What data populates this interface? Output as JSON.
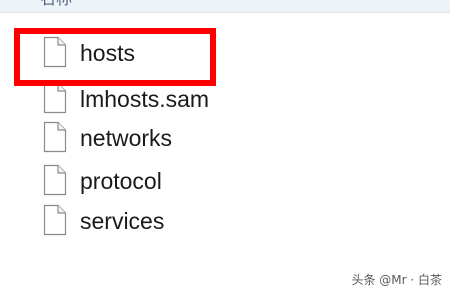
{
  "header": {
    "column_label": "名称"
  },
  "files": [
    {
      "name": "hosts",
      "icon": "file-icon",
      "highlighted": true
    },
    {
      "name": "lmhosts.sam",
      "icon": "file-icon",
      "highlighted": false
    },
    {
      "name": "networks",
      "icon": "file-icon",
      "highlighted": false
    },
    {
      "name": "protocol",
      "icon": "file-icon",
      "highlighted": false
    },
    {
      "name": "services",
      "icon": "file-icon",
      "highlighted": false
    }
  ],
  "highlight": {
    "color": "#ff0000"
  },
  "watermark": {
    "text": "头条 @Mr · 白茶"
  }
}
